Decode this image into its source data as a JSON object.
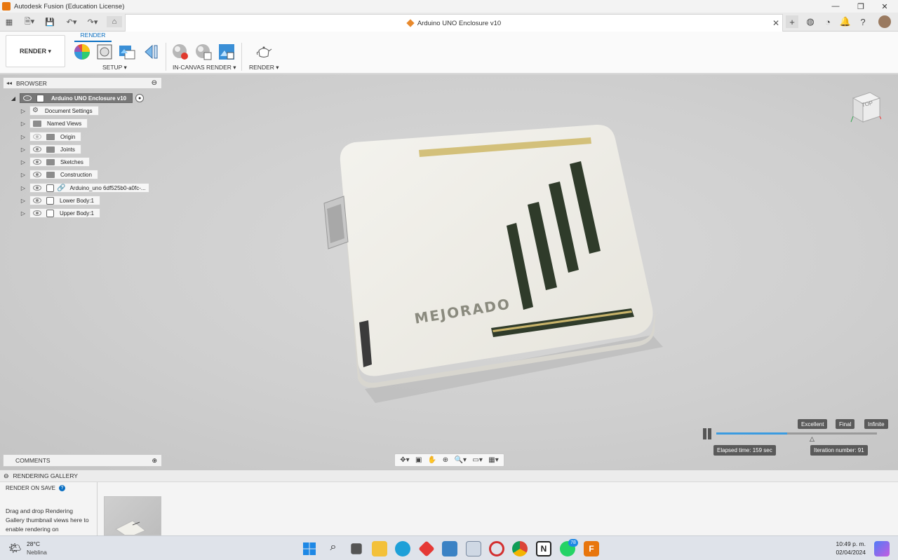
{
  "window": {
    "title": "Autodesk Fusion (Education License)"
  },
  "document": {
    "tab_title": "Arduino UNO Enclosure v10",
    "close": "✕"
  },
  "ribbon": {
    "workspace": "RENDER",
    "active_tab": "RENDER",
    "groups": [
      {
        "label": "SETUP ▾"
      },
      {
        "label": "IN-CANVAS RENDER ▾"
      },
      {
        "label": "RENDER ▾"
      }
    ]
  },
  "browser": {
    "title": "BROWSER",
    "root": "Arduino UNO Enclosure v10",
    "items": [
      {
        "label": "Document Settings",
        "icon": "gear-icon"
      },
      {
        "label": "Named Views",
        "icon": "folder-icon"
      },
      {
        "label": "Origin",
        "icon": "folder-icon"
      },
      {
        "label": "Joints",
        "icon": "folder-icon"
      },
      {
        "label": "Sketches",
        "icon": "folder-icon"
      },
      {
        "label": "Construction",
        "icon": "folder-icon"
      },
      {
        "label": "Arduino_uno 6df525b0-a0fc-...",
        "icon": "link-icon"
      },
      {
        "label": "Lower Body:1",
        "icon": "body-icon"
      },
      {
        "label": "Upper Body:1",
        "icon": "body-icon"
      }
    ]
  },
  "comments": {
    "title": "COMMENTS"
  },
  "viewcube": {
    "face": "TOP"
  },
  "model": {
    "engraving": "MEJORADO"
  },
  "render_progress": {
    "labels": [
      "Excellent",
      "Final",
      "Infinite"
    ],
    "elapsed": "Elapsed time: 159 sec",
    "iteration": "Iteration number: 91",
    "progress_fraction": 0.44
  },
  "gallery": {
    "title": "RENDERING GALLERY",
    "render_on_save": "RENDER ON SAVE",
    "help": "Drag and drop Rendering Gallery thumbnail views here to enable rendering on"
  },
  "taskbar": {
    "weather_temp": "28°C",
    "weather_desc": "Neblina",
    "time": "10:49 p. m.",
    "date": "02/04/2024",
    "whatsapp_badge": "78"
  },
  "colors": {
    "accent": "#0a6fc2",
    "progress": "#3b9be0",
    "fusion_orange": "#e8760d"
  }
}
